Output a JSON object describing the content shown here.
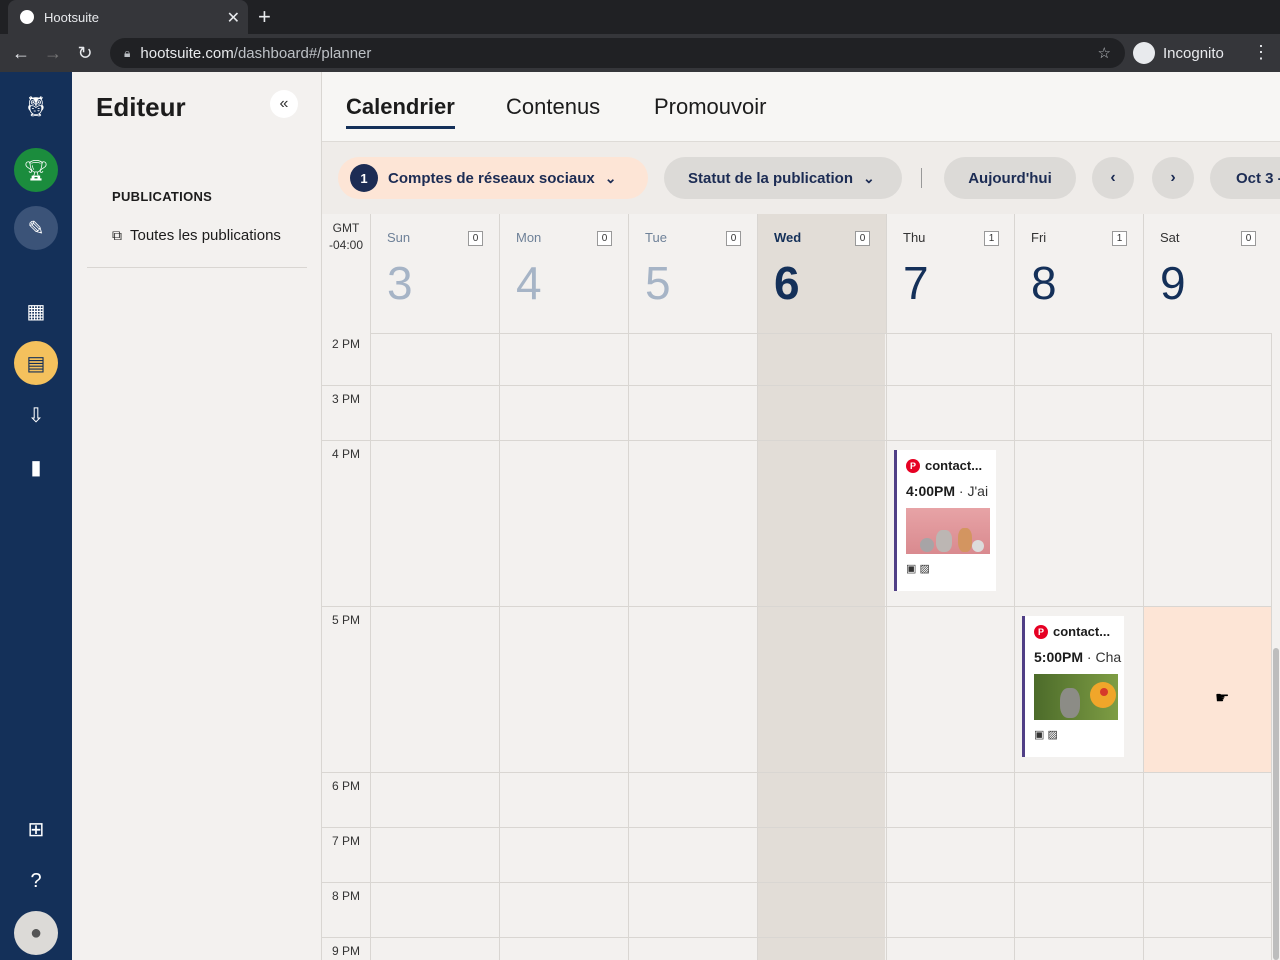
{
  "browser": {
    "tab_title": "Hootsuite",
    "url_host": "hootsuite.com",
    "url_path": "/dashboard#/planner",
    "profile": "Incognito"
  },
  "rail": {
    "icons": [
      "owl-logo-icon",
      "trophy-icon",
      "compose-icon",
      "dashboard-icon",
      "calendar-icon",
      "inbox-icon",
      "analytics-icon",
      "apps-icon",
      "help-icon",
      "profile-icon"
    ]
  },
  "editor": {
    "title": "Editeur",
    "section": "PUBLICATIONS",
    "all_posts": "Toutes les publications"
  },
  "nav": {
    "tabs": [
      "Calendrier",
      "Contenus",
      "Promouvoir"
    ]
  },
  "filters": {
    "accounts_count": "1",
    "accounts_label": "Comptes de réseaux sociaux",
    "status_label": "Statut de la publication",
    "today_label": "Aujourd'hui",
    "range_label": "Oct 3 -"
  },
  "calendar": {
    "tz_line1": "GMT",
    "tz_line2": "-04:00",
    "days": [
      {
        "name": "Sun",
        "date": "3",
        "count": "0"
      },
      {
        "name": "Mon",
        "date": "4",
        "count": "0"
      },
      {
        "name": "Tue",
        "date": "5",
        "count": "0"
      },
      {
        "name": "Wed",
        "date": "6",
        "count": "0"
      },
      {
        "name": "Thu",
        "date": "7",
        "count": "1"
      },
      {
        "name": "Fri",
        "date": "8",
        "count": "1"
      },
      {
        "name": "Sat",
        "date": "9",
        "count": "0"
      }
    ],
    "times": [
      "2 PM",
      "3 PM",
      "4 PM",
      "5 PM",
      "6 PM",
      "7 PM",
      "8 PM",
      "9 PM"
    ],
    "posts": [
      {
        "account": "contact...",
        "time": "4:00PM",
        "snippet": "J'ai"
      },
      {
        "account": "contact...",
        "time": "5:00PM",
        "snippet": "Cha"
      }
    ]
  },
  "colors": {
    "accent": "#143059",
    "pinterest": "#e60023",
    "highlight": "#fde5d6"
  }
}
